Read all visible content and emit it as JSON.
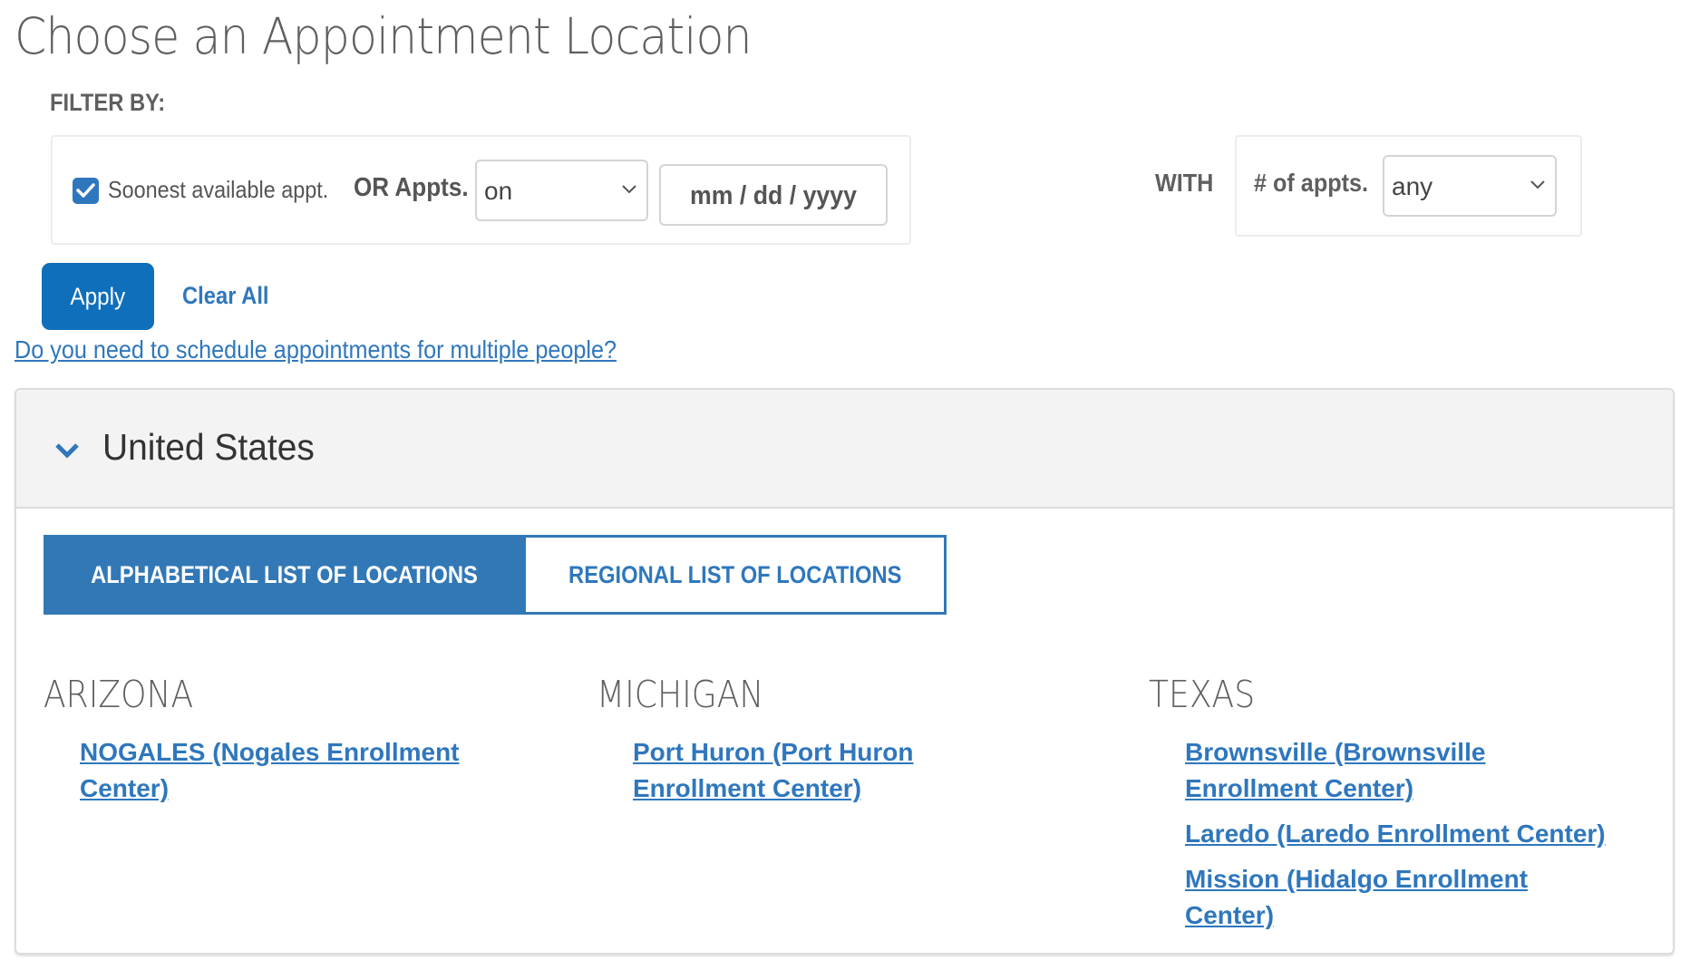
{
  "page": {
    "title": "Choose an Appointment Location",
    "filter_by_label": "FILTER BY:"
  },
  "filters": {
    "soonest_checked": true,
    "soonest_label": "Soonest available appt.",
    "or_appts_label": "OR Appts.",
    "date_mode_select": {
      "value": "on"
    },
    "date_input": {
      "placeholder": "mm / dd / yyyy",
      "value": ""
    },
    "with_label": "WITH",
    "num_appts_label": "# of appts.",
    "num_appts_select": {
      "value": "any"
    }
  },
  "actions": {
    "apply_label": "Apply",
    "clear_all_label": "Clear All",
    "multiple_people_link": "Do you need to schedule appointments for multiple people?"
  },
  "colors": {
    "accent": "#2f77bd",
    "button": "#0f6fbb",
    "panel_header_bg": "#f3f3f3"
  },
  "country_panel": {
    "title": "United States",
    "expanded": true,
    "tabs": [
      {
        "label": "ALPHABETICAL LIST OF LOCATIONS",
        "active": true
      },
      {
        "label": "REGIONAL LIST OF LOCATIONS",
        "active": false
      }
    ],
    "states": [
      {
        "name": "ARIZONA",
        "locations": [
          "NOGALES (Nogales Enrollment Center)"
        ]
      },
      {
        "name": "MICHIGAN",
        "locations": [
          "Port Huron (Port Huron Enrollment Center)"
        ]
      },
      {
        "name": "TEXAS",
        "locations": [
          "Brownsville (Brownsville Enrollment Center)",
          "Laredo (Laredo Enrollment Center)",
          "Mission (Hidalgo Enrollment Center)"
        ]
      }
    ]
  }
}
